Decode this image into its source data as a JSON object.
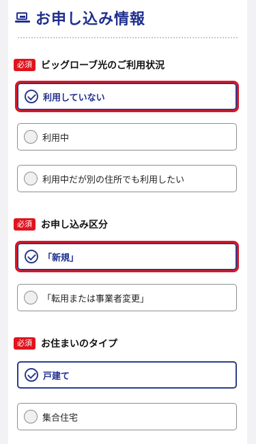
{
  "header": {
    "icon": "computer-icon",
    "title": "お申し込み情報"
  },
  "required_badge": "必須",
  "sections": [
    {
      "title": "ビッグローブ光のご利用状況",
      "options": [
        {
          "label": "利用していない",
          "selected": true
        },
        {
          "label": "利用中",
          "selected": false
        },
        {
          "label": "利用中だが別の住所でも利用したい",
          "selected": false
        }
      ]
    },
    {
      "title": "お申し込み区分",
      "options": [
        {
          "label": "「新規」",
          "selected": true
        },
        {
          "label": "「転用または事業者変更」",
          "selected": false
        }
      ]
    },
    {
      "title": "お住まいのタイプ",
      "options": [
        {
          "label": "戸建て",
          "selected": true
        },
        {
          "label": "集合住宅",
          "selected": false
        }
      ]
    }
  ],
  "colors": {
    "accent": "#1f2f8f",
    "required": "#e0141e",
    "highlight": "#e0141e"
  }
}
